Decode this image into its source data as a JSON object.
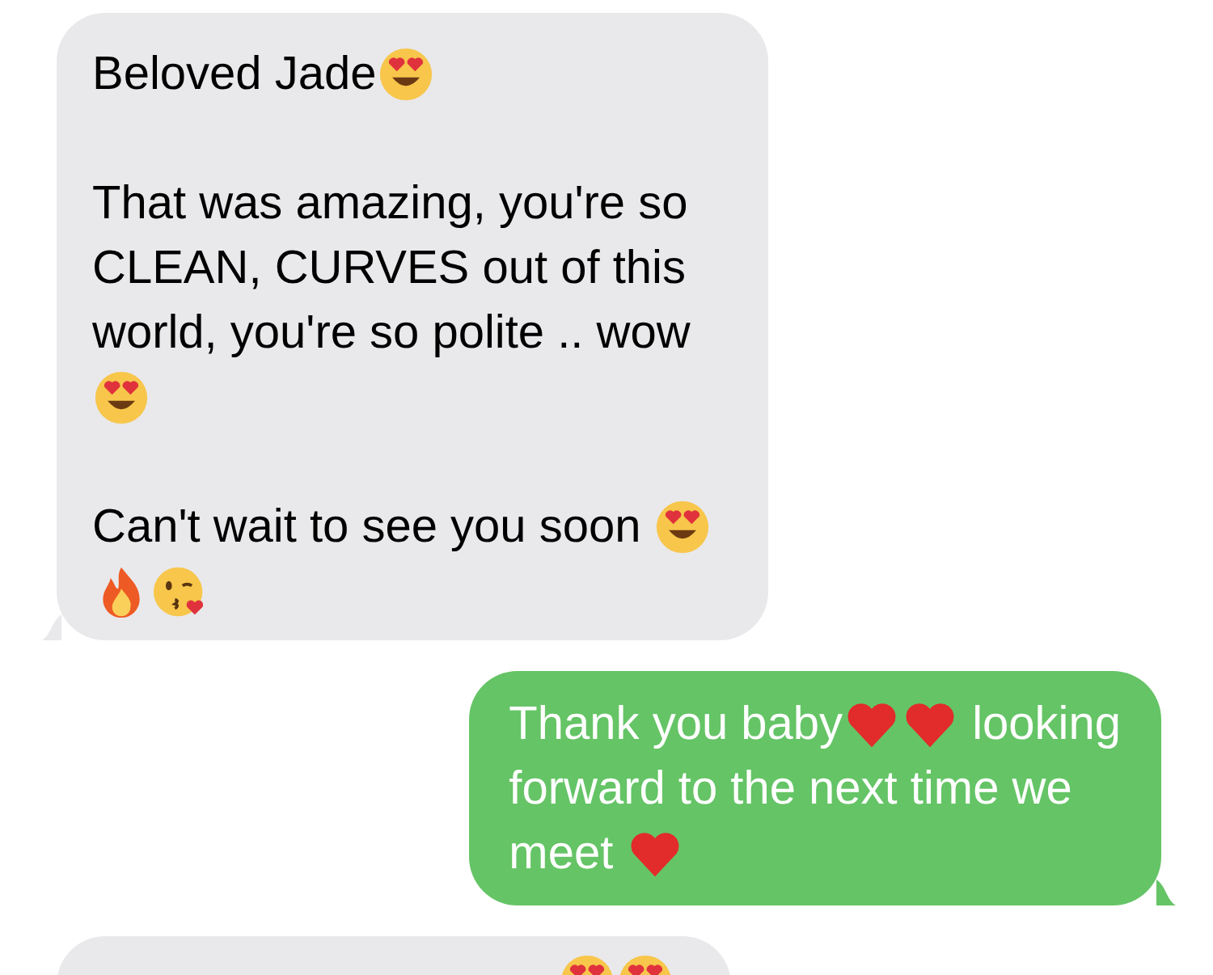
{
  "messages": [
    {
      "kind": "received",
      "paragraphs": [
        [
          [
            {
              "kind": "text",
              "text": "Beloved Jade"
            },
            {
              "kind": "heart-eyes"
            }
          ]
        ],
        [
          [
            {
              "kind": "text",
              "text": "That was amazing, you're so"
            }
          ],
          [
            {
              "kind": "text",
              "text": "CLEAN, CURVES out of this"
            }
          ],
          [
            {
              "kind": "text",
              "text": "world, you're so polite .. wow"
            }
          ],
          [
            {
              "kind": "heart-eyes"
            }
          ]
        ],
        [
          [
            {
              "kind": "text",
              "text": "Can't wait to see you soon "
            },
            {
              "kind": "heart-eyes"
            }
          ],
          [
            {
              "kind": "fire"
            },
            {
              "kind": "kiss"
            }
          ]
        ]
      ]
    },
    {
      "kind": "sent",
      "paragraphs": [
        [
          [
            {
              "kind": "text",
              "text": "Thank you baby"
            },
            {
              "kind": "heart"
            },
            {
              "kind": "heart"
            },
            {
              "kind": "text",
              "text": " looking"
            }
          ],
          [
            {
              "kind": "text",
              "text": "forward to the next time we"
            }
          ],
          [
            {
              "kind": "text",
              "text": "meet "
            },
            {
              "kind": "heart"
            }
          ]
        ]
      ]
    },
    {
      "kind": "received",
      "paragraphs": [
        [
          [
            {
              "kind": "heart-eyes"
            },
            {
              "kind": "heart-eyes"
            }
          ]
        ]
      ]
    }
  ]
}
